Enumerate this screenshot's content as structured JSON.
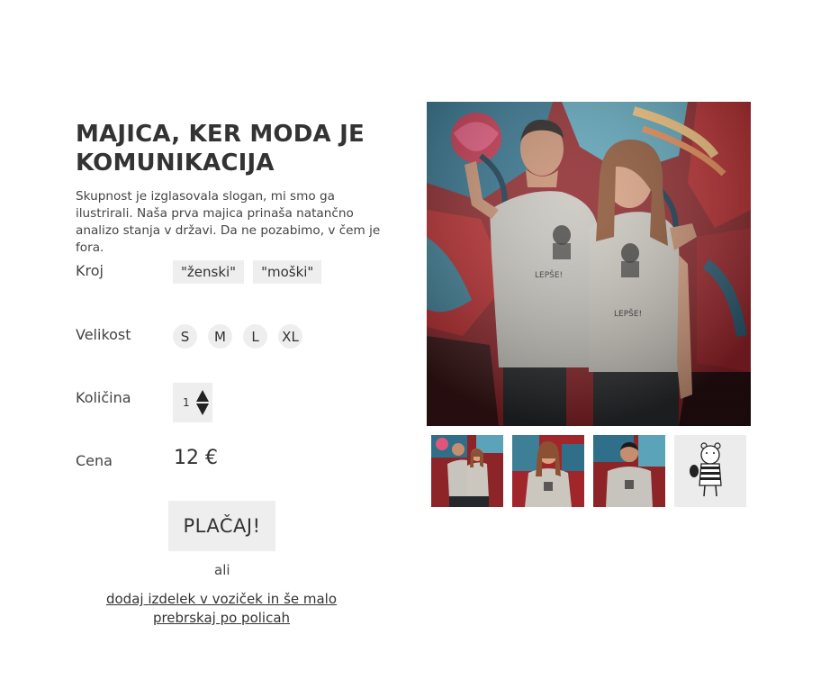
{
  "product": {
    "title": "MAJICA, KER MODA JE KOMUNIKACIJA",
    "description": "Skupnost je izglasovala slogan, mi smo ga ilustrirali. Naša prva majica prinaša natančno analizo stanja v državi. Da ne pozabimo, v čem je fora."
  },
  "options": {
    "cut": {
      "label": "Kroj",
      "choices": [
        "\"ženski\"",
        "\"moški\""
      ]
    },
    "size": {
      "label": "Velikost",
      "choices": [
        "S",
        "M",
        "L",
        "XL"
      ]
    },
    "quantity": {
      "label": "Količina",
      "value": "1"
    },
    "price": {
      "label": "Cena",
      "value": "12 €"
    }
  },
  "actions": {
    "pay_label": "PLAČAJ!",
    "or_label": "ali",
    "add_to_cart_label": "dodaj izdelek v voziček in še malo prebrskaj po policah"
  },
  "gallery": {
    "main": "photo-couple-graffiti",
    "thumbnails": [
      "thumb-couple",
      "thumb-woman",
      "thumb-man",
      "thumb-bear-illustration"
    ]
  },
  "colors": {
    "text": "#333333",
    "button_bg": "#eeeeee",
    "tshirt": "#c7c4bd",
    "graffiti_red": "#b8292c",
    "graffiti_teal": "#3d7f96"
  }
}
